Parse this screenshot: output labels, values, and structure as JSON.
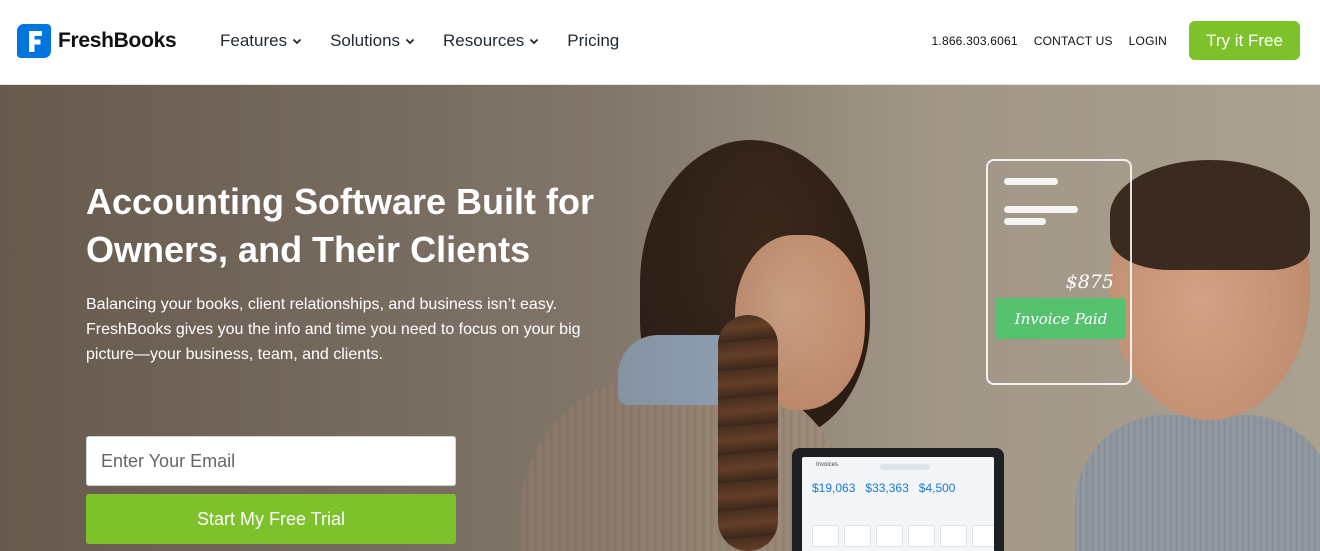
{
  "brand": {
    "name": "FreshBooks",
    "accent": "#7dc22b",
    "logo_color": "#0075dd"
  },
  "nav": {
    "items": [
      {
        "label": "Features",
        "has_dropdown": true
      },
      {
        "label": "Solutions",
        "has_dropdown": true
      },
      {
        "label": "Resources",
        "has_dropdown": true
      },
      {
        "label": "Pricing",
        "has_dropdown": false
      }
    ]
  },
  "utility": {
    "phone": "1.866.303.6061",
    "contact": "CONTACT US",
    "login": "LOGIN",
    "cta": "Try it Free"
  },
  "hero": {
    "title": "Accounting Software Built for Owners, and Their Clients",
    "description": "Balancing your books, client relationships, and business isn’t easy. FreshBooks gives you the info and time you need to focus on your big picture—your business, team, and clients.",
    "email_placeholder": "Enter Your Email",
    "submit_label": "Start My Free Trial"
  },
  "invoice_card": {
    "amount": "$875",
    "status": "Invoice Paid",
    "status_color": "#56c26f"
  },
  "laptop_screen": {
    "title": "Invoices",
    "amounts": [
      "$19,063",
      "$33,363",
      "$4,500"
    ]
  }
}
